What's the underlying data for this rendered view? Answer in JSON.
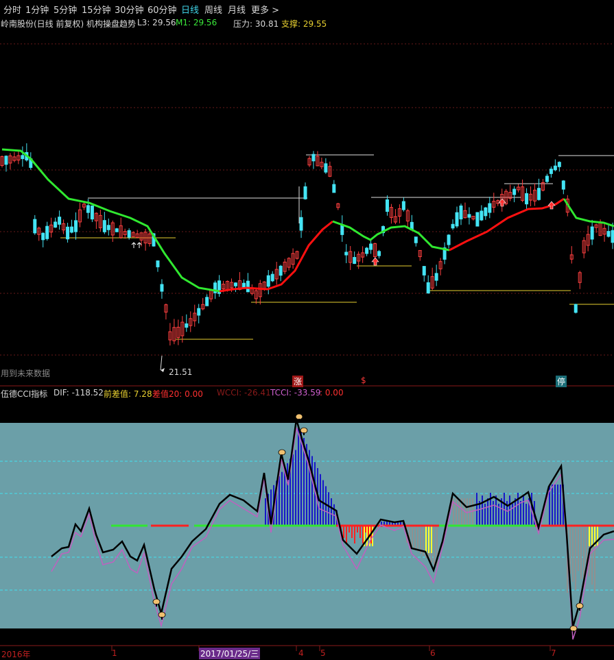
{
  "toolbar": {
    "items": [
      "分时",
      "1分钟",
      "5分钟",
      "15分钟",
      "30分钟",
      "60分钟",
      "日线",
      "周线",
      "月线",
      "更多 >"
    ],
    "active_index": 6
  },
  "main_header": {
    "title": "岭南股份(日线 前复权) 机构操盘趋势",
    "l3": "L3: 29.56",
    "m1": "M1: 29.56",
    "pressure": "压力: 30.81",
    "support": "支撑: 29.55"
  },
  "main_chart": {
    "low_marker": "21.51",
    "future_data_note": "用到未来数据",
    "event_labels": [
      "涨",
      "$",
      "停"
    ]
  },
  "indicator_header": {
    "name": "伍德CCI指标",
    "dif": "DIF: -118.52",
    "qcz": "前差值: 7.28",
    "cz20": "差值20: 0.00",
    "wcci": "WCCI: -26.41",
    "tcci": "TCCI: -33.59",
    "extra": ": 0.00"
  },
  "date_axis": {
    "labels": [
      "2016年",
      "1",
      "2017/01/25/三",
      "4",
      "5",
      "6",
      "7"
    ]
  },
  "colors": {
    "up_candle": "#ff4040",
    "down_candle": "#44e4f4",
    "trend_up": "#ff1010",
    "trend_down": "#30e830",
    "indicator_bg": "#6b9fa8",
    "highlight": "#3fd2e6",
    "date_text": "#c02020",
    "cursor_date_bg": "#6a2a8a"
  }
}
